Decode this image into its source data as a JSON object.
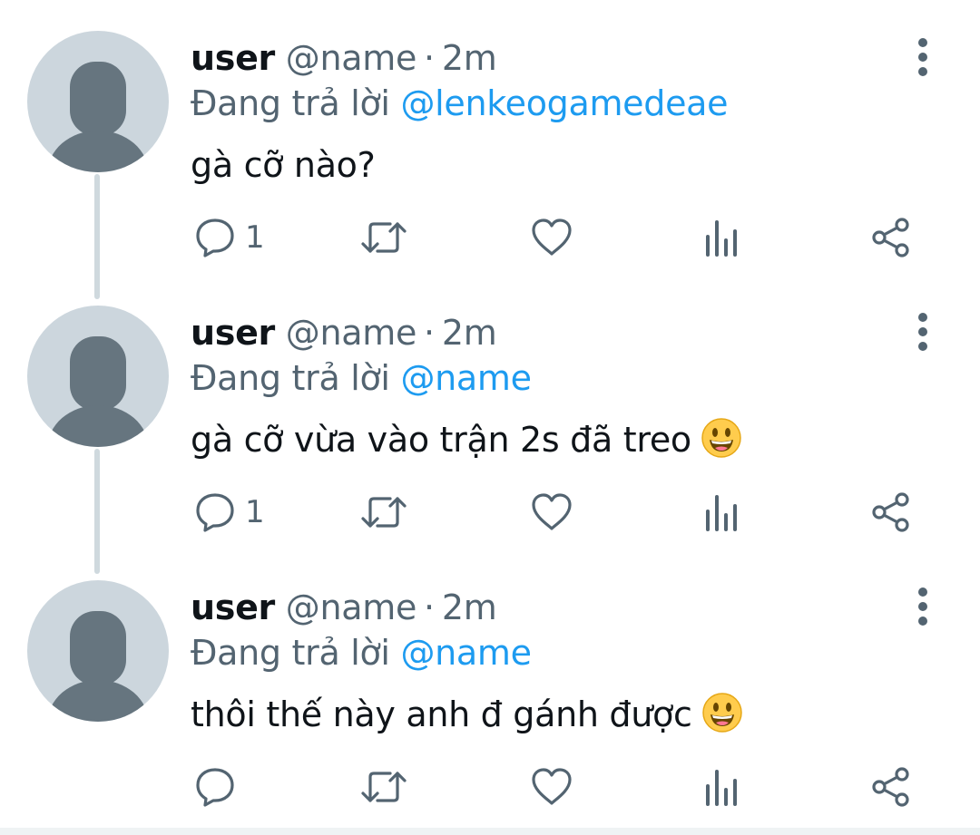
{
  "tweets": [
    {
      "display_name": "user",
      "handle": "@name",
      "separator": "·",
      "time": "2m",
      "reply_prefix": "Đang trả lời",
      "reply_to": "@lenkeogamedeae",
      "text": "gà cỡ nào?",
      "has_emoji": false,
      "reply_count": "1"
    },
    {
      "display_name": "user",
      "handle": "@name",
      "separator": "·",
      "time": "2m",
      "reply_prefix": "Đang trả lời",
      "reply_to": "@name",
      "text": "gà cỡ vừa vào trận 2s đã treo",
      "has_emoji": true,
      "emoji_name": "smiley-emoji",
      "reply_count": "1"
    },
    {
      "display_name": "user",
      "handle": "@name",
      "separator": "·",
      "time": "2m",
      "reply_prefix": "Đang trả lời",
      "reply_to": "@name",
      "text": "thôi thế này anh đ gánh được",
      "has_emoji": true,
      "emoji_name": "smiley-emoji",
      "reply_count": ""
    }
  ],
  "colors": {
    "text": "#0f1419",
    "secondary": "#536471",
    "link": "#1d9bf0",
    "avatar_bg": "#ccd6dd",
    "avatar_fg": "#66757f",
    "thread_line": "#cfd9de"
  },
  "icons": {
    "avatar": "default-profile-icon",
    "more": "more-vertical-icon",
    "reply": "reply-bubble-icon",
    "retweet": "retweet-icon",
    "like": "heart-icon",
    "views": "analytics-bars-icon",
    "share": "share-nodes-icon"
  }
}
